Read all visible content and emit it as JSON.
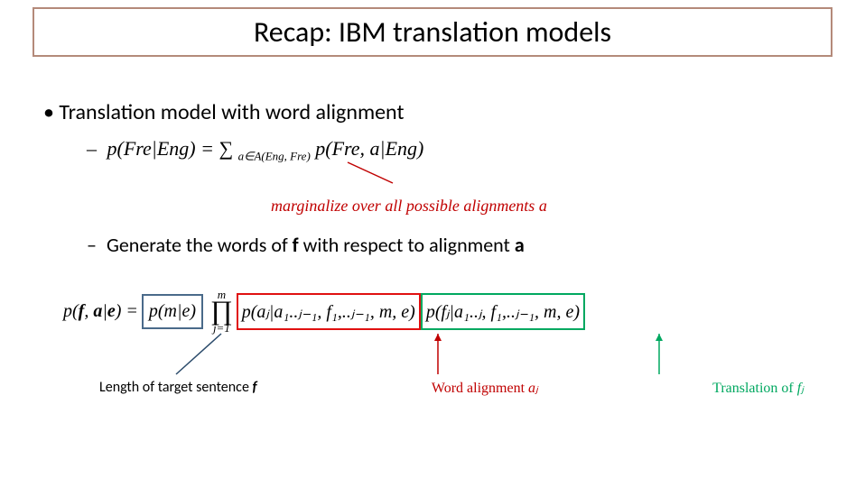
{
  "title": "Recap: IBM translation models",
  "bullet": "Translation model with word alignment",
  "eq1": {
    "dash": "–",
    "lhs": "p(Fre|Eng) = ",
    "sum": "∑",
    "sum_sub": "a∈A(Eng, Fre)",
    "rhs": " p(Fre, a|Eng)"
  },
  "marginalize": "marginalize over all possible alignments a",
  "generate": {
    "dash": "–",
    "pre": "Generate the words of ",
    "f": "f",
    "mid": " with respect to alignment ",
    "a": "a"
  },
  "eq2": {
    "lhs_open": "p(",
    "f": "f",
    "comma1": ", ",
    "a": "a",
    "bar": "|",
    "e": "e",
    "lhs_close": ") =",
    "blue": "p(m|e)",
    "prod_top": "m",
    "prod_sym": "∏",
    "prod_bot": "j=1",
    "red": "p(aⱼ|a₁..ⱼ₋₁, f₁,..ⱼ₋₁, m, e)",
    "green": "p(fⱼ|a₁..ⱼ, f₁,..ⱼ₋₁, m, e)"
  },
  "labels": {
    "black_pre": "Length of target sentence ",
    "black_f": "f",
    "red_pre": "Word alignment ",
    "red_var": "aⱼ",
    "green_pre": "Translation of ",
    "green_var": "fⱼ"
  }
}
